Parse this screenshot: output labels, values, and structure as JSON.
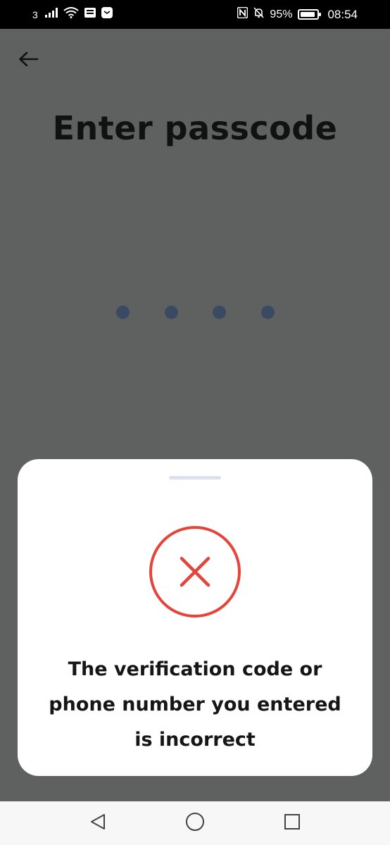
{
  "status_bar": {
    "carrier": "3",
    "battery": "95%",
    "time": "08:54",
    "icons": [
      "signal-icon",
      "wifi-icon",
      "message-icon",
      "app-notification-icon",
      "nfc-icon",
      "bell-off-icon",
      "battery-icon"
    ]
  },
  "header": {
    "back_icon": "arrow-left-icon",
    "title": "Enter passcode"
  },
  "passcode": {
    "length": 4,
    "dot_color": "#3a4a63"
  },
  "error_sheet": {
    "icon": "error-x-icon",
    "accent": "#e5443a",
    "message_line1": "The verification code or",
    "message_line2": "phone number you entered",
    "message_line3": "is incorrect"
  },
  "nav_bar": {
    "back": "triangle-back-icon",
    "home": "circle-home-icon",
    "recents": "square-recents-icon"
  }
}
